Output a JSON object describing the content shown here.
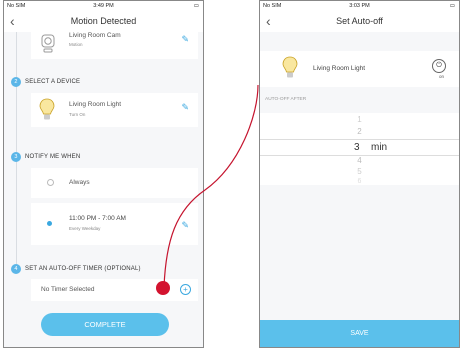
{
  "left": {
    "status": {
      "carrier": "No SIM",
      "time": "3:49 PM"
    },
    "title": "Motion Detected",
    "trigger_device": {
      "name": "Living Room Cam",
      "sub": "Motion"
    },
    "steps": [
      {
        "num": "2",
        "label": "SELECT A DEVICE"
      },
      {
        "num": "3",
        "label": "NOTIFY ME WHEN"
      },
      {
        "num": "4",
        "label": "SET AN AUTO-OFF TIMER (OPTIONAL)"
      }
    ],
    "device": {
      "name": "Living Room Light",
      "sub": "Turn On"
    },
    "notify_options": [
      {
        "label": "Always",
        "sub": ""
      },
      {
        "label": "11:00 PM - 7:00 AM",
        "sub": "Every Weekday"
      }
    ],
    "timer_value": "No Timer Selected",
    "complete_label": "COMPLETE"
  },
  "right": {
    "status": {
      "carrier": "No SIM",
      "time": "3:03 PM"
    },
    "title": "Set Auto-off",
    "device": {
      "name": "Living Room Light",
      "state": "on"
    },
    "section_label": "AUTO-OFF AFTER",
    "picker_values": [
      "1",
      "2",
      "3",
      "4",
      "5",
      "6"
    ],
    "picker_selected": "3",
    "picker_unit": "min",
    "save_label": "SAVE"
  },
  "colors": {
    "accent": "#5bc0eb",
    "connector": "#c5142e",
    "icon_blue": "#3aa8e0"
  }
}
